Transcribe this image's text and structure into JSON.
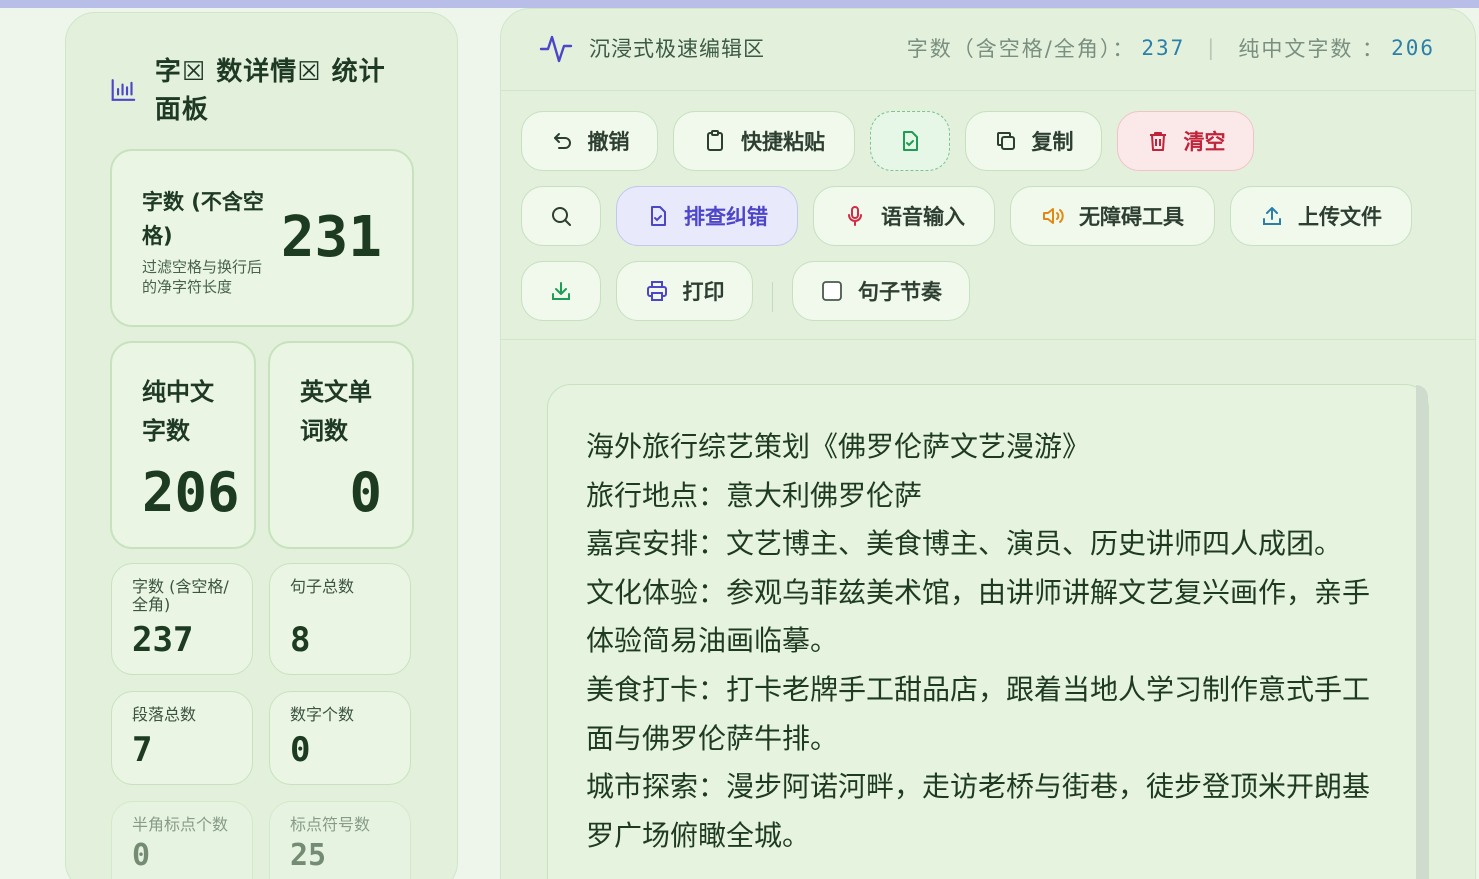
{
  "stats": {
    "title": "字☒ 数详情☒ 统计面板",
    "main_card": {
      "label": "字数 (不含空格)",
      "sub": "过滤空格与换行后的净字符长度",
      "value": "231"
    },
    "chinese_card": {
      "label": "纯中文字数",
      "value": "206"
    },
    "english_card": {
      "label": "英文单词数",
      "value": "0"
    },
    "small_cards": [
      {
        "label": "字数 (含空格/全角)",
        "value": "237"
      },
      {
        "label": "句子总数",
        "value": "8"
      },
      {
        "label": "段落总数",
        "value": "7"
      },
      {
        "label": "数字个数",
        "value": "0"
      },
      {
        "label": "半角标点个数",
        "value": "0"
      },
      {
        "label": "标点符号数",
        "value": "25"
      }
    ]
  },
  "editor": {
    "title": "沉浸式极速编辑区",
    "metric1_label": "字数（含空格/全角）：",
    "metric1_value": "237",
    "separator": "|",
    "metric2_label": "纯中文字数 ：",
    "metric2_value": "206"
  },
  "toolbar": {
    "undo": "撤销",
    "paste": "快捷粘贴",
    "copy": "复制",
    "clear": "清空",
    "check": "排查纠错",
    "voice": "语音输入",
    "accessibility": "无障碍工具",
    "upload": "上传文件",
    "print": "打印",
    "rhythm": "句子节奏"
  },
  "document": {
    "text": "海外旅行综艺策划《佛罗伦萨文艺漫游》\n旅行地点：意大利佛罗伦萨\n嘉宾安排：文艺博主、美食博主、演员、历史讲师四人成团。\n文化体验：参观乌菲兹美术馆，由讲师讲解文艺复兴画作，亲手体验简易油画临摹。\n美食打卡：打卡老牌手工甜品店，跟着当地人学习制作意式手工面与佛罗伦萨牛排。\n城市探索：漫步阿诺河畔，走访老桥与街巷，徒步登顶米开朗基罗广场俯瞰全城。"
  },
  "colors": {
    "accent_blue": "#2c7fa8",
    "danger": "#c0243a",
    "active_purple": "#4d46c8",
    "panel_bg": "#e3f1dc"
  }
}
